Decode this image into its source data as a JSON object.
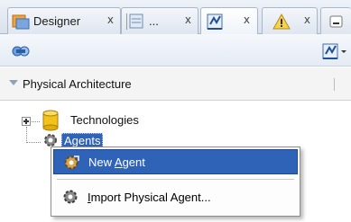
{
  "tabs": [
    {
      "label": "Designer",
      "close": "x",
      "icon": "designer-icon"
    },
    {
      "label": "...",
      "close": "x",
      "icon": "document-icon"
    },
    {
      "label": "",
      "close": "x",
      "icon": "topology-icon"
    },
    {
      "label": "",
      "close": "x",
      "icon": "warning-icon"
    },
    {
      "label": "",
      "close": "",
      "icon": "minimize-icon"
    }
  ],
  "toolbar": {
    "left_icon": "connect-icon",
    "right_icon": "topology-menu-icon"
  },
  "section": {
    "title": "Physical Architecture"
  },
  "tree": {
    "technologies": "Technologies",
    "agents": "Agents"
  },
  "context_menu": {
    "items": [
      {
        "label_pre": "New ",
        "label_accel": "A",
        "label_post": "gent",
        "icon": "gear-icon",
        "highlighted": true
      },
      {
        "label_pre": "",
        "label_accel": "I",
        "label_post": "mport Physical Agent...",
        "icon": "gear-icon",
        "highlighted": false
      }
    ]
  },
  "colors": {
    "selection": "#2f63b8",
    "tab_border": "#a9b7cb",
    "database_yellow": "#f2c21a"
  }
}
